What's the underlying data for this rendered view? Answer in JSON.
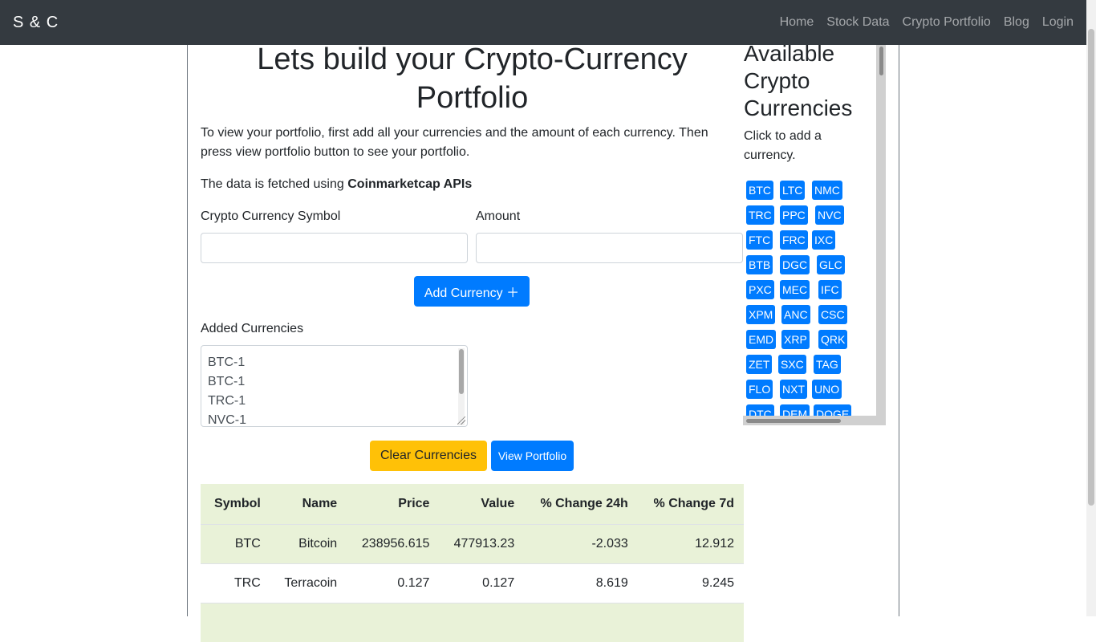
{
  "navbar": {
    "brand": "S & C",
    "links": [
      "Home",
      "Stock Data",
      "Crypto Portfolio",
      "Blog",
      "Login"
    ]
  },
  "main": {
    "heading": "Lets build your Crypto-Currency Portfolio",
    "intro": "To view your portfolio, first add all your currencies and the amount of each currency. Then press view portfolio button to see your portfolio.",
    "data_prefix": "The data is fetched using ",
    "data_source": "Coinmarketcap APIs",
    "symbol_label": "Crypto Currency Symbol",
    "symbol_value": "",
    "amount_label": "Amount",
    "amount_value": "",
    "add_button": "Add Currency ＋",
    "added_label": "Added Currencies",
    "added_items": [
      "BTC-1",
      "BTC-1",
      "TRC-1",
      "NVC-1"
    ],
    "clear_button": "Clear Currencies",
    "view_button": "View Portfolio"
  },
  "table": {
    "headers": [
      "Symbol",
      "Name",
      "Price",
      "Value",
      "% Change 24h",
      "% Change 7d"
    ],
    "rows": [
      [
        "BTC",
        "Bitcoin",
        "238956.615",
        "477913.23",
        "-2.033",
        "12.912"
      ],
      [
        "TRC",
        "Terracoin",
        "0.127",
        "0.127",
        "8.619",
        "9.245"
      ]
    ]
  },
  "side": {
    "title": "Available Crypto Currencies",
    "subtitle": "Click to add a currency.",
    "symbols": [
      [
        "BTC",
        "LTC",
        "NMC"
      ],
      [
        "TRC",
        "PPC",
        "NVC"
      ],
      [
        "FTC",
        "FRC",
        "IXC"
      ],
      [
        "BTB",
        "DGC",
        "GLC"
      ],
      [
        "PXC",
        "MEC",
        "IFC"
      ],
      [
        "XPM",
        "ANC",
        "CSC"
      ],
      [
        "EMD",
        "XRP",
        "QRK"
      ],
      [
        "ZET",
        "SXC",
        "TAG"
      ],
      [
        "FLO",
        "NXT",
        "UNO"
      ],
      [
        "DTC",
        "DEM",
        "DOGE"
      ]
    ]
  },
  "colors": {
    "navbar": "#343a40",
    "primary": "#007bff",
    "warning": "#ffc107",
    "row_stripe": "#e9f2d8"
  }
}
